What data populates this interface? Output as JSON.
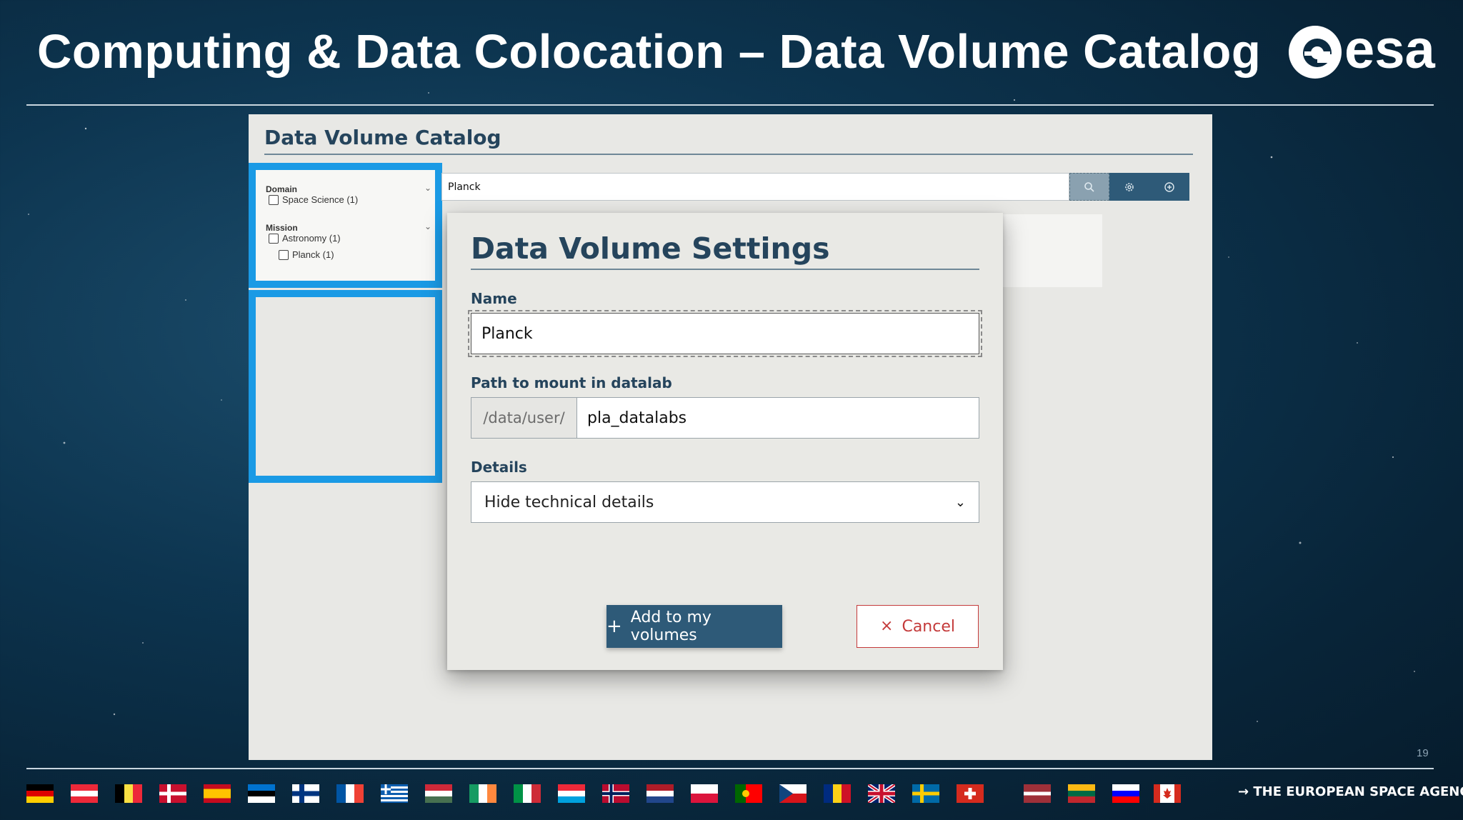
{
  "slide": {
    "title": "Computing & Data Colocation – Data Volume Catalog",
    "logo_text": "esa",
    "page_number": "19",
    "agency": "→ THE EUROPEAN SPACE AGENCY"
  },
  "catalog": {
    "title": "Data Volume Catalog",
    "facets": [
      {
        "heading": "Domain",
        "items": [
          {
            "label": "Space Science (1)",
            "checked": false
          }
        ]
      },
      {
        "heading": "Mission",
        "items": [
          {
            "label": "Astronomy (1)",
            "checked": false
          },
          {
            "label": "Planck (1)",
            "checked": false
          }
        ]
      }
    ],
    "search": {
      "value": "Planck"
    },
    "toolbar_icons": [
      "search-icon",
      "gear-icon",
      "add-circle-icon"
    ]
  },
  "modal": {
    "title": "Data Volume Settings",
    "name_label": "Name",
    "name_value": "Planck",
    "path_label": "Path to mount in datalab",
    "path_prefix": "/data/user/",
    "path_value": "pla_datalabs",
    "details_label": "Details",
    "details_selected": "Hide technical details",
    "add_button": "Add to my volumes",
    "cancel_button": "Cancel"
  },
  "colors": {
    "primary": "#2e5a78",
    "heading": "#25445c",
    "highlight": "#1a9ae5",
    "danger": "#c43a3a"
  },
  "flags": [
    "Germany",
    "Austria",
    "Belgium",
    "Denmark",
    "Spain",
    "Estonia",
    "Finland",
    "France",
    "Greece",
    "Hungary",
    "Ireland",
    "Italy",
    "Luxembourg",
    "Norway",
    "Netherlands",
    "Poland",
    "Portugal",
    "Czech Republic",
    "Romania",
    "United Kingdom",
    "Sweden",
    "Switzerland",
    "Latvia",
    "Lithuania",
    "Slovenia",
    "Canada"
  ]
}
